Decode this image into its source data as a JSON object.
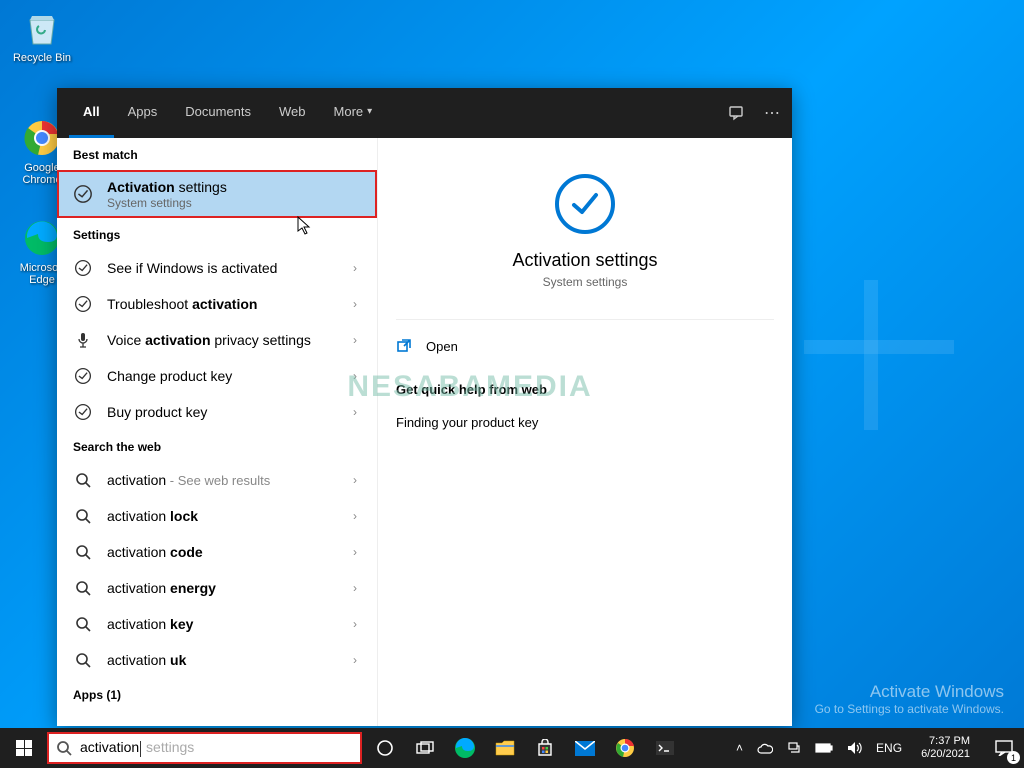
{
  "desktop": {
    "recycle": "Recycle Bin",
    "chrome": "Google Chrome",
    "edge": "Microsoft Edge"
  },
  "search": {
    "tabs": {
      "all": "All",
      "apps": "Apps",
      "documents": "Documents",
      "web": "Web",
      "more": "More"
    },
    "sections": {
      "best": "Best match",
      "settings": "Settings",
      "web": "Search the web",
      "apps": "Apps (1)"
    },
    "best_match": {
      "title_b": "Activation",
      "title_r": " settings",
      "sub": "System settings"
    },
    "settings_items": [
      {
        "plain": "See if Windows is activated",
        "bold": ""
      },
      {
        "plain": "Troubleshoot ",
        "bold": "activation"
      },
      {
        "plain": "Voice ",
        "bold": "activation",
        "plain2": " privacy settings",
        "icon": "mic"
      },
      {
        "plain": "Change product key",
        "bold": ""
      },
      {
        "plain": "Buy product key",
        "bold": ""
      }
    ],
    "web_items": [
      {
        "q": "activation",
        "hint": " - See web results",
        "bold": ""
      },
      {
        "q": "activation ",
        "bold": "lock"
      },
      {
        "q": "activation ",
        "bold": "code"
      },
      {
        "q": "activation ",
        "bold": "energy"
      },
      {
        "q": "activation ",
        "bold": "key"
      },
      {
        "q": "activation ",
        "bold": "uk"
      }
    ],
    "preview": {
      "title": "Activation settings",
      "sub": "System settings",
      "open": "Open",
      "quick_header": "Get quick help from web",
      "quick_link": "Finding your product key"
    },
    "input": {
      "value": "activation",
      "ghost": " settings"
    }
  },
  "watermark": "NESABAMEDIA",
  "activate": {
    "l1": "Activate Windows",
    "l2": "Go to Settings to activate Windows."
  },
  "tray": {
    "lang": "ENG",
    "time": "7:37 PM",
    "date": "6/20/2021",
    "notif_count": "1"
  }
}
